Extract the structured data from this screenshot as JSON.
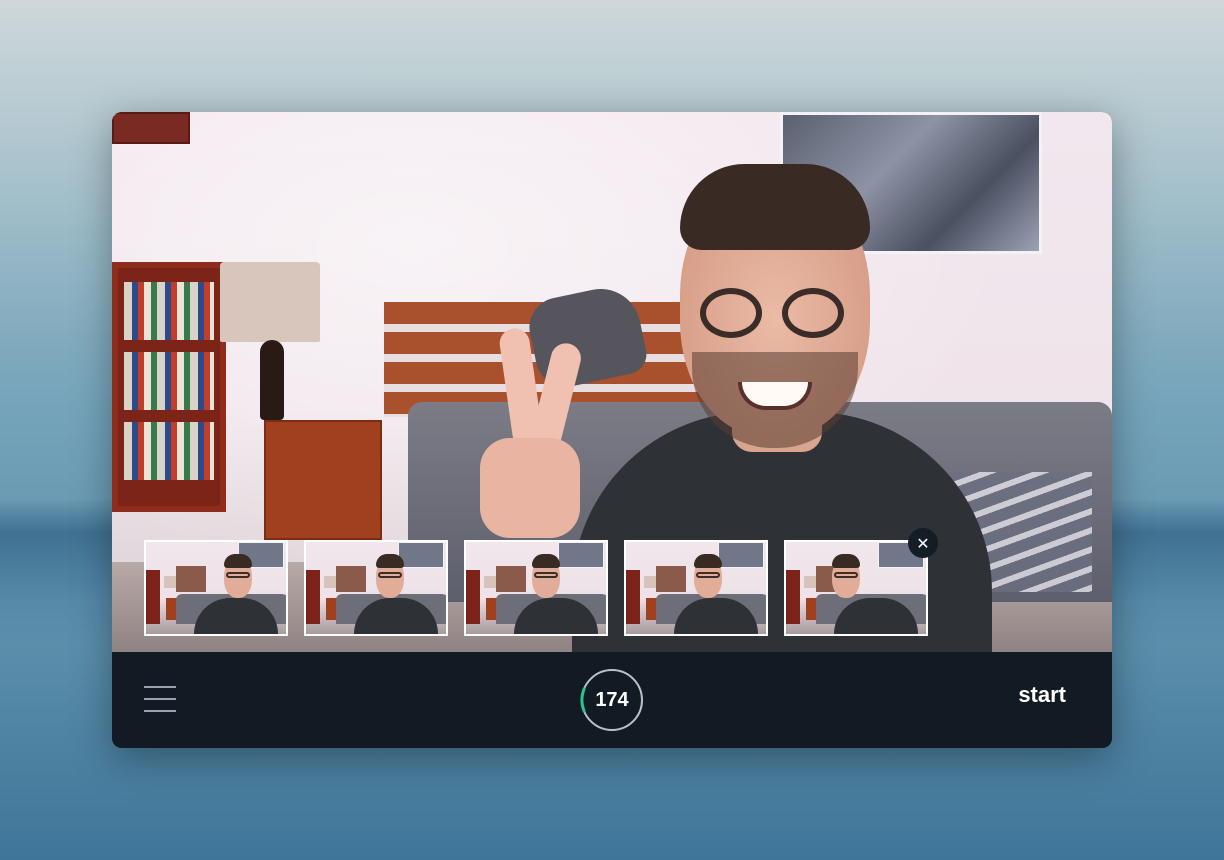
{
  "counter": {
    "value": "174",
    "progress_fraction": 0.12,
    "progress_color": "#2bc48a",
    "ring_color": "#b9c0c8"
  },
  "toolbar": {
    "start_label": "start",
    "menu_icon": "hamburger-menu-icon"
  },
  "thumbnails": {
    "count": 5,
    "delete_icon": "close-icon",
    "delete_glyph": "✕"
  },
  "colors": {
    "toolbar_background": "#121a24",
    "thumbnail_border": "#ffffff"
  }
}
